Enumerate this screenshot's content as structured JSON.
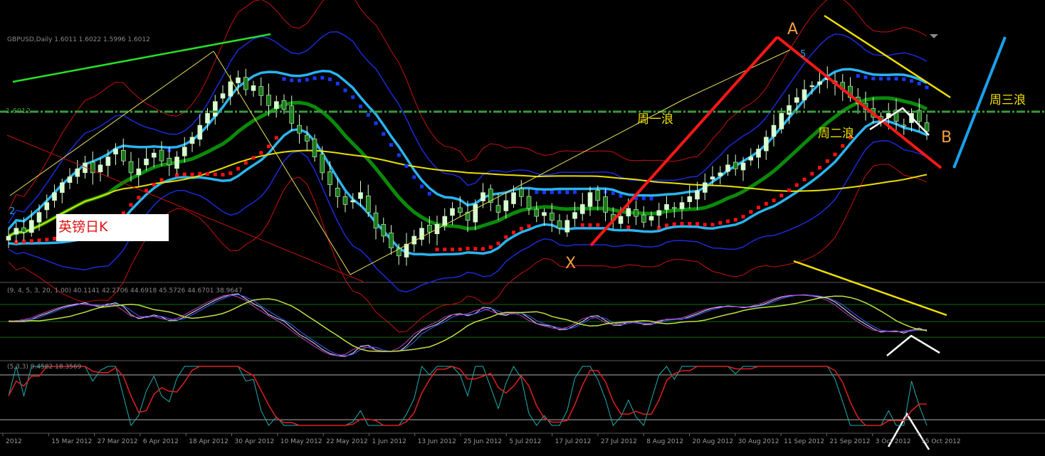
{
  "chart_data": {
    "type": "candlestick-with-indicators",
    "title": "",
    "header_text": "GBPUSD,Daily  1.6011 1.6022 1.5996 1.6012",
    "price_tag": "1.6012",
    "symbol_label": "英镑日K",
    "x_tick_labels": [
      "2012",
      "15 Mar 2012",
      "27 Mar 2012",
      "6 Apr 2012",
      "18 Apr 2012",
      "30 Apr 2012",
      "10 May 2012",
      "22 May 2012",
      "1 Jun 2012",
      "13 Jun 2012",
      "25 Jun 2012",
      "5 Jul 2012",
      "17 Jul 2012",
      "27 Jul 2012",
      "8 Aug 2012",
      "20 Aug 2012",
      "30 Aug 2012",
      "11 Sep 2012",
      "21 Sep 2012",
      "3 Oct 2012",
      "15 Oct 2012"
    ],
    "wave_labels": {
      "a": "A",
      "b": "B",
      "x": "X",
      "two": "2",
      "five": "5",
      "wave1": "周一浪",
      "wave2": "周二浪",
      "wave3": "周三浪"
    },
    "indicator1_header": "(9, 4, 5, 3, 20, 1.00) 40.1141 42.2706 44.6918 45.5726 44.6701 38.9647",
    "indicator2_header": "(5,3,3) 9.4582 18.3569",
    "stoch_levels": [
      80,
      20
    ],
    "closes": [
      1.548,
      1.552,
      1.55,
      1.556,
      1.56,
      1.565,
      1.57,
      1.575,
      1.578,
      1.582,
      1.585,
      1.58,
      1.584,
      1.588,
      1.592,
      1.586,
      1.58,
      1.582,
      1.587,
      1.59,
      1.586,
      1.584,
      1.588,
      1.593,
      1.598,
      1.604,
      1.61,
      1.616,
      1.62,
      1.626,
      1.628,
      1.622,
      1.624,
      1.619,
      1.614,
      1.616,
      1.612,
      1.605,
      1.6,
      1.596,
      1.588,
      1.58,
      1.574,
      1.568,
      1.564,
      1.566,
      1.57,
      1.56,
      1.552,
      1.548,
      1.542,
      1.538,
      1.544,
      1.548,
      1.552,
      1.55,
      1.554,
      1.558,
      1.562,
      1.56,
      1.556,
      1.564,
      1.57,
      1.565,
      1.56,
      1.566,
      1.57,
      1.568,
      1.562,
      1.558,
      1.56,
      1.556,
      1.552,
      1.556,
      1.56,
      1.564,
      1.57,
      1.566,
      1.56,
      1.556,
      1.558,
      1.562,
      1.558,
      1.555,
      1.558,
      1.561,
      1.564,
      1.562,
      1.565,
      1.568,
      1.571,
      1.575,
      1.578,
      1.58,
      1.584,
      1.582,
      1.585,
      1.588,
      1.592,
      1.598,
      1.604,
      1.61,
      1.614,
      1.618,
      1.622,
      1.624,
      1.626,
      1.628,
      1.625,
      1.622,
      1.618,
      1.615,
      1.612,
      1.608,
      1.606,
      1.61,
      1.606,
      1.604,
      1.61,
      1.606,
      1.601
    ],
    "series_colors": {
      "up_candle": "#d8ffd0",
      "down_candle": "#1a7a1a",
      "bb_outer": "#1a2ad8",
      "bb_mid": "#2ab4f0",
      "ma_green": "#0a8a0a",
      "ma_yellow": "#e8e000",
      "band_red": "#c81010",
      "psar_red": "#ff1010",
      "psar_blue": "#1838ff",
      "trend_green": "#28e028",
      "trend_red": "#ff1818",
      "trend_yellow": "#f0e000",
      "trend_blue": "#1aa0ee",
      "label_orange": "#f0a040"
    }
  }
}
